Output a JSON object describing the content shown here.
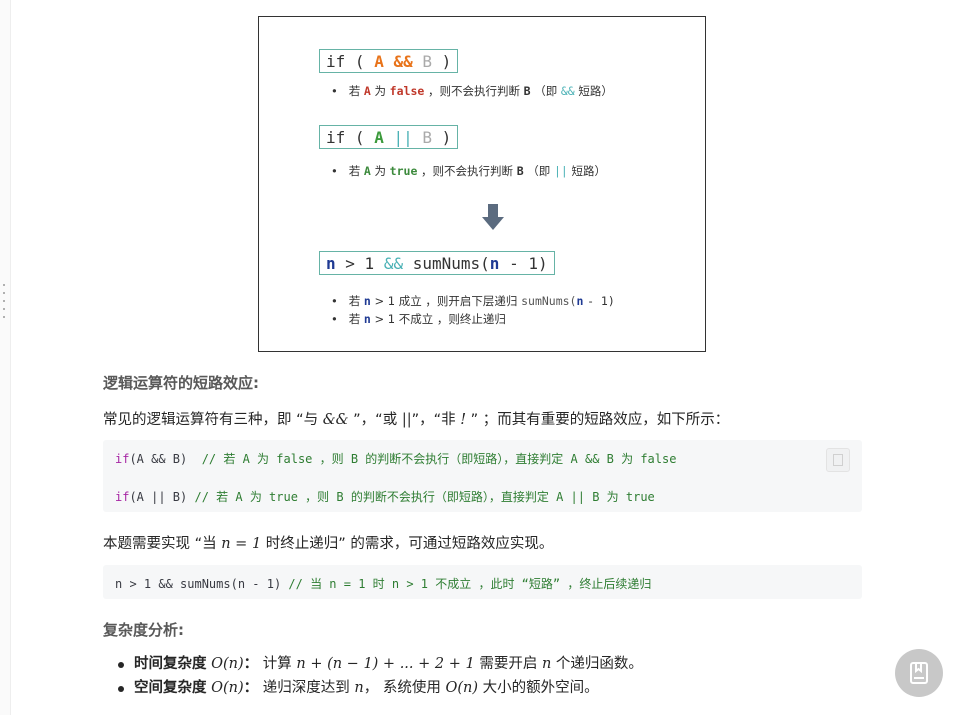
{
  "figure": {
    "box1": {
      "if": "if",
      "lp": "(",
      "a": "A",
      "op": "&&",
      "b": "B",
      "rp": ")"
    },
    "note1": {
      "bullet": "•",
      "p1": "若",
      "a": "A",
      "p2": "为",
      "val": "false",
      "p3": "，则不会执行判断",
      "b": "B",
      "p4": "（即",
      "op": "&&",
      "p5": "短路）"
    },
    "box2": {
      "if": "if",
      "lp": "(",
      "a": "A",
      "op": "||",
      "b": "B",
      "rp": ")"
    },
    "note2": {
      "bullet": "•",
      "p1": "若",
      "a": "A",
      "p2": "为",
      "val": "true",
      "p3": "，则不会执行判断",
      "b": "B",
      "p4": "（即",
      "op": "||",
      "p5": "短路）"
    },
    "box3": {
      "n1": "n",
      "gt": "> 1",
      "op": "&&",
      "fn": "sumNums(",
      "n2": "n",
      "rest": "- 1)"
    },
    "note3": {
      "bullet": "•",
      "p1": "若",
      "n": "n",
      "p2": "> 1 成立 ，则开启下层递归",
      "fn": "sumNums(",
      "n2": "n",
      "p3": "- 1)"
    },
    "note4": {
      "bullet": "•",
      "p1": "若",
      "n": "n",
      "p2": "> 1 不成立 ，则终止递归"
    }
  },
  "section1": {
    "heading": "逻辑运算符的短路效应:",
    "intro": {
      "p1": "常见的逻辑运算符有三种，即 “与 ",
      "and": "&&",
      "p2": " ”，“或 ",
      "or": "||",
      "p3": "”，“非 ",
      "not": "!",
      "p4": " ” ；而其有重要的短路效应，如下所示："
    },
    "code1": {
      "line1": {
        "kw": "if",
        "code": "(A && B)",
        "comment": "// 若 A 为 false ，则 B 的判断不会执行（即短路），直接判定 A && B 为 false"
      },
      "line2": {
        "kw": "if",
        "code": "(A || B)",
        "comment": "// 若 A 为 true ，则 B 的判断不会执行（即短路），直接判定 A || B 为 true"
      }
    },
    "para2": {
      "p1": "本题需要实现 “当 ",
      "math": "n = 1",
      "p2": " 时终止递归” 的需求，可通过短路效应实现。"
    },
    "code2": {
      "code": "n > 1 && sumNums(n - 1)",
      "comment": "// 当 n = 1 时 n > 1 不成立 ，此时 “短路” ，终止后续递归"
    }
  },
  "section2": {
    "heading": "复杂度分析:",
    "items": [
      {
        "label": "时间复杂度",
        "math": "O(n)",
        "colon": "：",
        "p1": "计算 ",
        "expr": "n + (n − 1) + ... + 2 + 1",
        "p2": " 需要开启 ",
        "n": "n",
        "p3": " 个递归函数。"
      },
      {
        "label": "空间复杂度",
        "math": "O(n)",
        "colon": "：",
        "p1": "递归深度达到 ",
        "n": "n",
        "p2": "， 系统使用 ",
        "math2": "O(n)",
        "p3": " 大小的额外空间。"
      }
    ]
  },
  "icons": {
    "fab": "bookmark-icon",
    "copy": "copy-icon"
  }
}
